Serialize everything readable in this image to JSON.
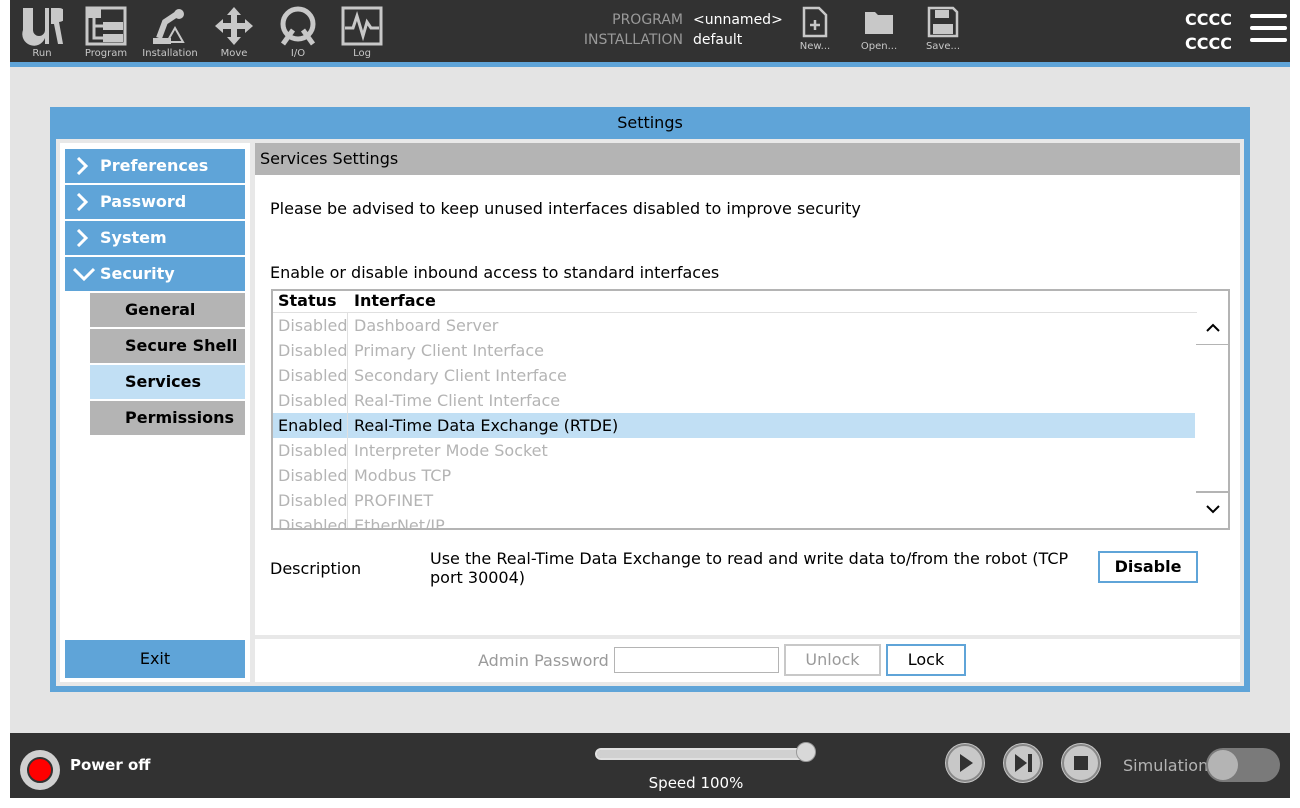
{
  "topbar": {
    "nav": [
      {
        "label": "Run",
        "icon": "ur-logo-icon"
      },
      {
        "label": "Program",
        "icon": "program-icon"
      },
      {
        "label": "Installation",
        "icon": "installation-icon"
      },
      {
        "label": "Move",
        "icon": "move-icon"
      },
      {
        "label": "I/O",
        "icon": "io-icon"
      },
      {
        "label": "Log",
        "icon": "log-icon"
      }
    ],
    "program_label": "PROGRAM",
    "program_value": "<unnamed>",
    "installation_label": "INSTALLATION",
    "installation_value": "default",
    "file_buttons": [
      {
        "label": "New...",
        "icon": "new-file-icon"
      },
      {
        "label": "Open...",
        "icon": "open-folder-icon"
      },
      {
        "label": "Save...",
        "icon": "save-disk-icon"
      }
    ],
    "robot_name_line1": "CCCC",
    "robot_name_line2": "CCCC",
    "accent_color": "#5fa4d8"
  },
  "dialog": {
    "title": "Settings",
    "sidebar": {
      "items": [
        {
          "label": "Preferences",
          "expanded": false
        },
        {
          "label": "Password",
          "expanded": false
        },
        {
          "label": "System",
          "expanded": false
        },
        {
          "label": "Security",
          "expanded": true
        }
      ],
      "sub_items": [
        {
          "label": "General",
          "active": false
        },
        {
          "label": "Secure Shell",
          "active": false
        },
        {
          "label": "Services",
          "active": true
        },
        {
          "label": "Permissions",
          "active": false
        }
      ],
      "exit_label": "Exit"
    },
    "content": {
      "header": "Services Settings",
      "advice": "Please be advised to keep unused interfaces disabled to improve security",
      "enable_label": "Enable or disable inbound access to standard interfaces",
      "table": {
        "columns": [
          "Status",
          "Interface"
        ],
        "rows": [
          {
            "status": "Disabled",
            "interface": "Dashboard Server"
          },
          {
            "status": "Disabled",
            "interface": "Primary Client Interface"
          },
          {
            "status": "Disabled",
            "interface": "Secondary Client Interface"
          },
          {
            "status": "Disabled",
            "interface": "Real-Time Client Interface"
          },
          {
            "status": "Enabled",
            "interface": "Real-Time Data Exchange (RTDE)",
            "selected": true
          },
          {
            "status": "Disabled",
            "interface": "Interpreter Mode Socket"
          },
          {
            "status": "Disabled",
            "interface": "Modbus TCP"
          },
          {
            "status": "Disabled",
            "interface": "PROFINET"
          },
          {
            "status": "Disabled",
            "interface": "EtherNet/IP"
          }
        ]
      },
      "description_label": "Description",
      "description_text": "Use the Real-Time Data Exchange to read and write data to/from the robot (TCP port 30004)",
      "toggle_button": "Disable"
    },
    "footer": {
      "admin_password_label": "Admin Password",
      "admin_password_value": "",
      "unlock_label": "Unlock",
      "lock_label": "Lock"
    }
  },
  "bottombar": {
    "power_label": "Power off",
    "speed_label": "Speed 100%",
    "speed_fraction": 1.0,
    "simulation_label": "Simulation",
    "simulation_on": false,
    "controls": [
      "play-icon",
      "step-icon",
      "stop-icon"
    ]
  }
}
